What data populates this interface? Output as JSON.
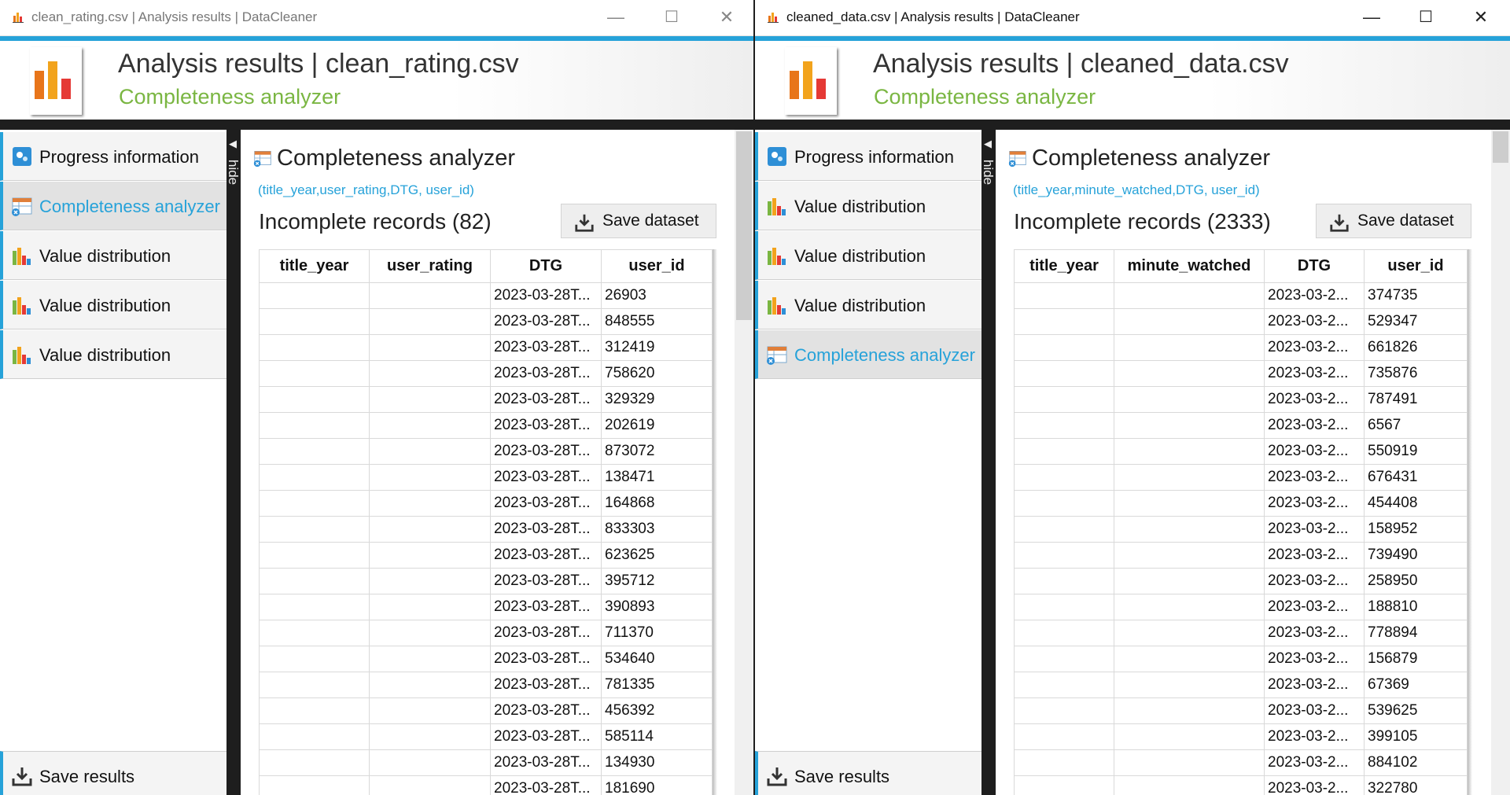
{
  "windows": [
    {
      "title_bar": "clean_rating.csv | Analysis results | DataCleaner",
      "header": {
        "title": "Analysis results",
        "file": "clean_rating.csv",
        "subtitle": "Completeness analyzer"
      },
      "sidebar": {
        "items": [
          {
            "label": "Progress information",
            "icon": "progress-icon",
            "active": false
          },
          {
            "label": "Completeness analyzer",
            "icon": "completeness-icon",
            "active": true
          },
          {
            "label": "Value distribution",
            "icon": "bar-chart-icon",
            "active": false
          },
          {
            "label": "Value distribution",
            "icon": "bar-chart-icon",
            "active": false
          },
          {
            "label": "Value distribution",
            "icon": "bar-chart-icon",
            "active": false
          }
        ],
        "save_results": "Save results"
      },
      "divider_label": "hide",
      "content": {
        "title": "Completeness analyzer",
        "columns_text": "(title_year,user_rating,DTG, user_id)",
        "incomplete": "Incomplete records (82)",
        "save_dataset": "Save dataset",
        "table": {
          "headers": [
            "title_year",
            "user_rating",
            "DTG",
            "user_id"
          ],
          "rows": [
            [
              "",
              "",
              "2023-03-28T...",
              "26903"
            ],
            [
              "",
              "",
              "2023-03-28T...",
              "848555"
            ],
            [
              "",
              "",
              "2023-03-28T...",
              "312419"
            ],
            [
              "",
              "",
              "2023-03-28T...",
              "758620"
            ],
            [
              "",
              "",
              "2023-03-28T...",
              "329329"
            ],
            [
              "",
              "",
              "2023-03-28T...",
              "202619"
            ],
            [
              "",
              "",
              "2023-03-28T...",
              "873072"
            ],
            [
              "",
              "",
              "2023-03-28T...",
              "138471"
            ],
            [
              "",
              "",
              "2023-03-28T...",
              "164868"
            ],
            [
              "",
              "",
              "2023-03-28T...",
              "833303"
            ],
            [
              "",
              "",
              "2023-03-28T...",
              "623625"
            ],
            [
              "",
              "",
              "2023-03-28T...",
              "395712"
            ],
            [
              "",
              "",
              "2023-03-28T...",
              "390893"
            ],
            [
              "",
              "",
              "2023-03-28T...",
              "711370"
            ],
            [
              "",
              "",
              "2023-03-28T...",
              "534640"
            ],
            [
              "",
              "",
              "2023-03-28T...",
              "781335"
            ],
            [
              "",
              "",
              "2023-03-28T...",
              "456392"
            ],
            [
              "",
              "",
              "2023-03-28T...",
              "585114"
            ],
            [
              "",
              "",
              "2023-03-28T...",
              "134930"
            ],
            [
              "",
              "",
              "2023-03-28T...",
              "181690"
            ]
          ]
        }
      }
    },
    {
      "title_bar": "cleaned_data.csv | Analysis results | DataCleaner",
      "header": {
        "title": "Analysis results",
        "file": "cleaned_data.csv",
        "subtitle": "Completeness analyzer"
      },
      "sidebar": {
        "items": [
          {
            "label": "Progress information",
            "icon": "progress-icon",
            "active": false
          },
          {
            "label": "Value distribution",
            "icon": "bar-chart-icon",
            "active": false
          },
          {
            "label": "Value distribution",
            "icon": "bar-chart-icon",
            "active": false
          },
          {
            "label": "Value distribution",
            "icon": "bar-chart-icon",
            "active": false
          },
          {
            "label": "Completeness analyzer",
            "icon": "completeness-icon",
            "active": true
          }
        ],
        "save_results": "Save results"
      },
      "divider_label": "hide",
      "content": {
        "title": "Completeness analyzer",
        "columns_text": "(title_year,minute_watched,DTG, user_id)",
        "incomplete": "Incomplete records (2333)",
        "save_dataset": "Save dataset",
        "table": {
          "headers": [
            "title_year",
            "minute_watched",
            "DTG",
            "user_id"
          ],
          "rows": [
            [
              "",
              "",
              "2023-03-2...",
              "374735"
            ],
            [
              "",
              "",
              "2023-03-2...",
              "529347"
            ],
            [
              "",
              "",
              "2023-03-2...",
              "661826"
            ],
            [
              "",
              "",
              "2023-03-2...",
              "735876"
            ],
            [
              "",
              "",
              "2023-03-2...",
              "787491"
            ],
            [
              "",
              "",
              "2023-03-2...",
              "6567"
            ],
            [
              "",
              "",
              "2023-03-2...",
              "550919"
            ],
            [
              "",
              "",
              "2023-03-2...",
              "676431"
            ],
            [
              "",
              "",
              "2023-03-2...",
              "454408"
            ],
            [
              "",
              "",
              "2023-03-2...",
              "158952"
            ],
            [
              "",
              "",
              "2023-03-2...",
              "739490"
            ],
            [
              "",
              "",
              "2023-03-2...",
              "258950"
            ],
            [
              "",
              "",
              "2023-03-2...",
              "188810"
            ],
            [
              "",
              "",
              "2023-03-2...",
              "778894"
            ],
            [
              "",
              "",
              "2023-03-2...",
              "156879"
            ],
            [
              "",
              "",
              "2023-03-2...",
              "67369"
            ],
            [
              "",
              "",
              "2023-03-2...",
              "539625"
            ],
            [
              "",
              "",
              "2023-03-2...",
              "399105"
            ],
            [
              "",
              "",
              "2023-03-2...",
              "884102"
            ],
            [
              "",
              "",
              "2023-03-2...",
              "322780"
            ]
          ]
        }
      }
    }
  ],
  "window_controls": {
    "minimize": "—",
    "maximize": "☐",
    "close": "✕"
  },
  "colors": {
    "accent": "#26a2d9",
    "subtitle": "#7ab642",
    "dark": "#1e1e1e"
  }
}
